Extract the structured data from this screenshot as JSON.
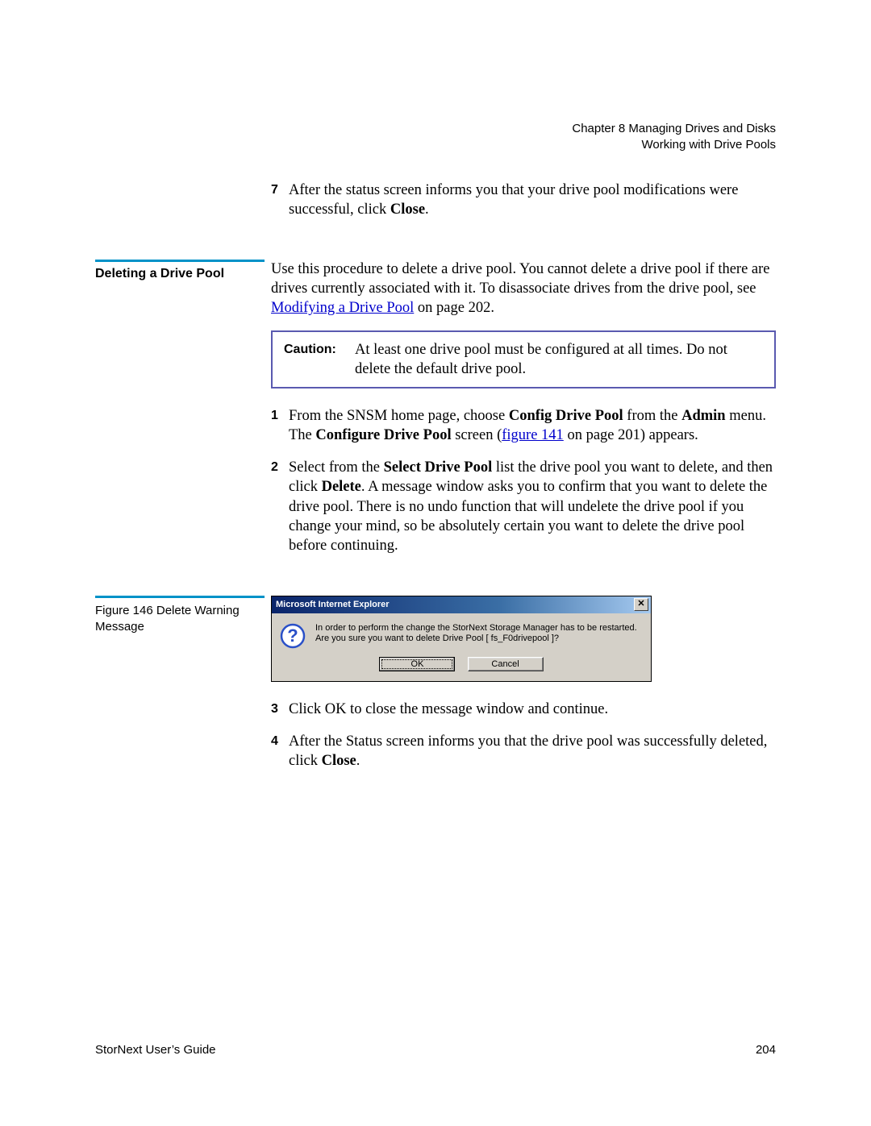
{
  "header": {
    "line1": "Chapter 8  Managing Drives and Disks",
    "line2": "Working with Drive Pools"
  },
  "prev_step": {
    "num": "7",
    "text_a": "After the status screen informs you that your drive pool modifications were successful, click ",
    "text_b": "Close",
    "text_c": "."
  },
  "section": {
    "heading": "Deleting a Drive Pool",
    "intro_a": "Use this procedure to delete a drive pool. You cannot delete a drive pool if there are drives currently associated with it. To disassociate drives from the drive pool, see ",
    "intro_link": "Modifying a Drive Pool",
    "intro_b": " on page  202."
  },
  "caution": {
    "label": "Caution:",
    "text": "At least one drive pool must be configured at all times. Do not delete the default drive pool."
  },
  "steps": {
    "s1": {
      "num": "1",
      "a": "From the SNSM home page, choose ",
      "b": "Config Drive Pool",
      "c": " from the ",
      "d": "Admin",
      "e": " menu. The ",
      "f": "Configure Drive Pool",
      "g": " screen (",
      "link": "figure 141",
      "h": " on page 201) appears."
    },
    "s2": {
      "num": "2",
      "a": "Select from the ",
      "b": "Select Drive Pool",
      "c": " list the drive pool you want to delete, and then click ",
      "d": "Delete",
      "e": ". A message window asks you to confirm that you want to delete the drive pool. There is no undo function that will undelete the drive pool if you change your mind, so be absolutely certain you want to delete the drive pool before continuing."
    },
    "s3": {
      "num": "3",
      "a": "Click OK to close the message window and continue."
    },
    "s4": {
      "num": "4",
      "a": "After the Status screen informs you that the drive pool was successfully deleted, click ",
      "b": "Close",
      "c": "."
    }
  },
  "figure": {
    "caption": "Figure 146  Delete Warning Message",
    "dialog": {
      "title": "Microsoft Internet Explorer",
      "msg1": "In order to perform the change the StorNext Storage Manager has to be restarted.",
      "msg2": "Are you sure you want to delete Drive Pool [ fs_F0drivepool ]?",
      "ok": "OK",
      "cancel": "Cancel",
      "close_glyph": "✕"
    }
  },
  "footer": {
    "left": "StorNext User’s Guide",
    "right": "204"
  }
}
